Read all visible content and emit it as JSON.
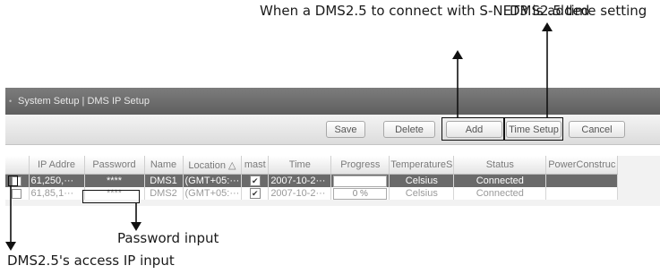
{
  "callouts": {
    "add": "When a DMS2.5 to connect with S-NET3 is added",
    "time": "DMS2.5 time setting",
    "password": "Password input",
    "ip": "DMS2.5's access IP input"
  },
  "window": {
    "breadcrumb": "System Setup | DMS IP Setup"
  },
  "toolbar": {
    "save": "Save",
    "delete": "Delete",
    "add": "Add",
    "time_setup": "Time Setup",
    "cancel": "Cancel"
  },
  "table": {
    "headers": [
      "IP Addre",
      "Password",
      "Name",
      "Location △",
      "mast",
      "Time",
      "Progress",
      "TemperatureS",
      "Status",
      "PowerConstruc"
    ],
    "rows": [
      {
        "ip": "61,250,···",
        "password": "****",
        "name": "DMS1",
        "location": "(GMT+05:···",
        "master": true,
        "time": "2007-10-2···",
        "progress": "",
        "temperature": "Celsius",
        "status": "Connected",
        "power": "",
        "selected": true
      },
      {
        "ip": "61,85,1···",
        "password": "****",
        "name": "DMS2",
        "location": "(GMT+05:···",
        "master": true,
        "time": "2007-10-2···",
        "progress": "0 %",
        "temperature": "Celsius",
        "status": "Connected",
        "power": "",
        "selected": false
      }
    ]
  }
}
